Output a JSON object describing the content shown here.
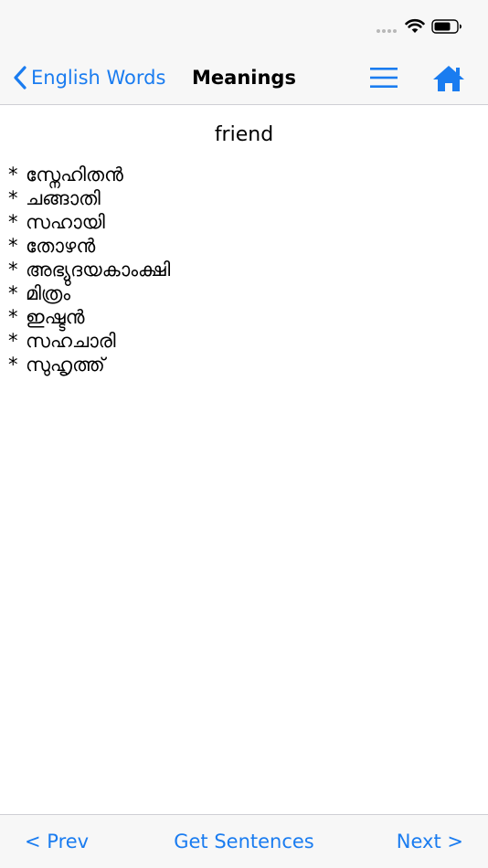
{
  "nav": {
    "back_label": "English Words",
    "title": "Meanings"
  },
  "content": {
    "word": "friend",
    "bullet": "*",
    "meanings": [
      "സ്നേഹിതൻ",
      "ചങ്ങാതി",
      "സഹായി",
      "തോഴൻ",
      "അഭ്യുദയകാംക്ഷി",
      "മിത്രം",
      "ഇഷ്ടൻ",
      "സഹചാരി",
      "സുഹൃത്ത്"
    ]
  },
  "toolbar": {
    "prev_label": "< Prev",
    "sentences_label": "Get Sentences",
    "next_label": "Next >"
  },
  "colors": {
    "accent": "#1a7cf0",
    "bar_background": "#f7f7f7"
  },
  "icons": {
    "back": "chevron-left-icon",
    "menu": "hamburger-menu-icon",
    "home": "home-icon",
    "wifi": "wifi-icon",
    "battery": "battery-icon"
  }
}
